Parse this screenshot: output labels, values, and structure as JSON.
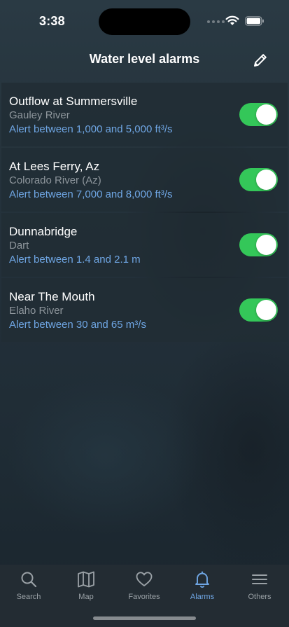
{
  "status_bar": {
    "time": "3:38"
  },
  "header": {
    "title": "Water level alarms",
    "edit_icon": "pencil-icon"
  },
  "alarms": [
    {
      "name": "Outflow at Summersville",
      "river": "Gauley River",
      "range": "Alert between 1,000 and 5,000 ft³/s",
      "enabled": true
    },
    {
      "name": "At Lees Ferry, Az",
      "river": "Colorado River (Az)",
      "range": "Alert between 7,000 and 8,000 ft³/s",
      "enabled": true
    },
    {
      "name": "Dunnabridge",
      "river": "Dart",
      "range": "Alert between 1.4 and 2.1 m",
      "enabled": true
    },
    {
      "name": "Near The Mouth",
      "river": "Elaho River",
      "range": "Alert between 30 and 65 m³/s",
      "enabled": true
    }
  ],
  "tab_bar": {
    "tabs": [
      {
        "label": "Search",
        "icon": "search-icon"
      },
      {
        "label": "Map",
        "icon": "map-icon"
      },
      {
        "label": "Favorites",
        "icon": "heart-icon"
      },
      {
        "label": "Alarms",
        "icon": "bell-icon"
      },
      {
        "label": "Others",
        "icon": "menu-icon"
      }
    ],
    "active": "Alarms"
  },
  "colors": {
    "toggle_on": "#34c759",
    "accent": "#6fa6e4",
    "secondary_text": "#8e969c"
  }
}
